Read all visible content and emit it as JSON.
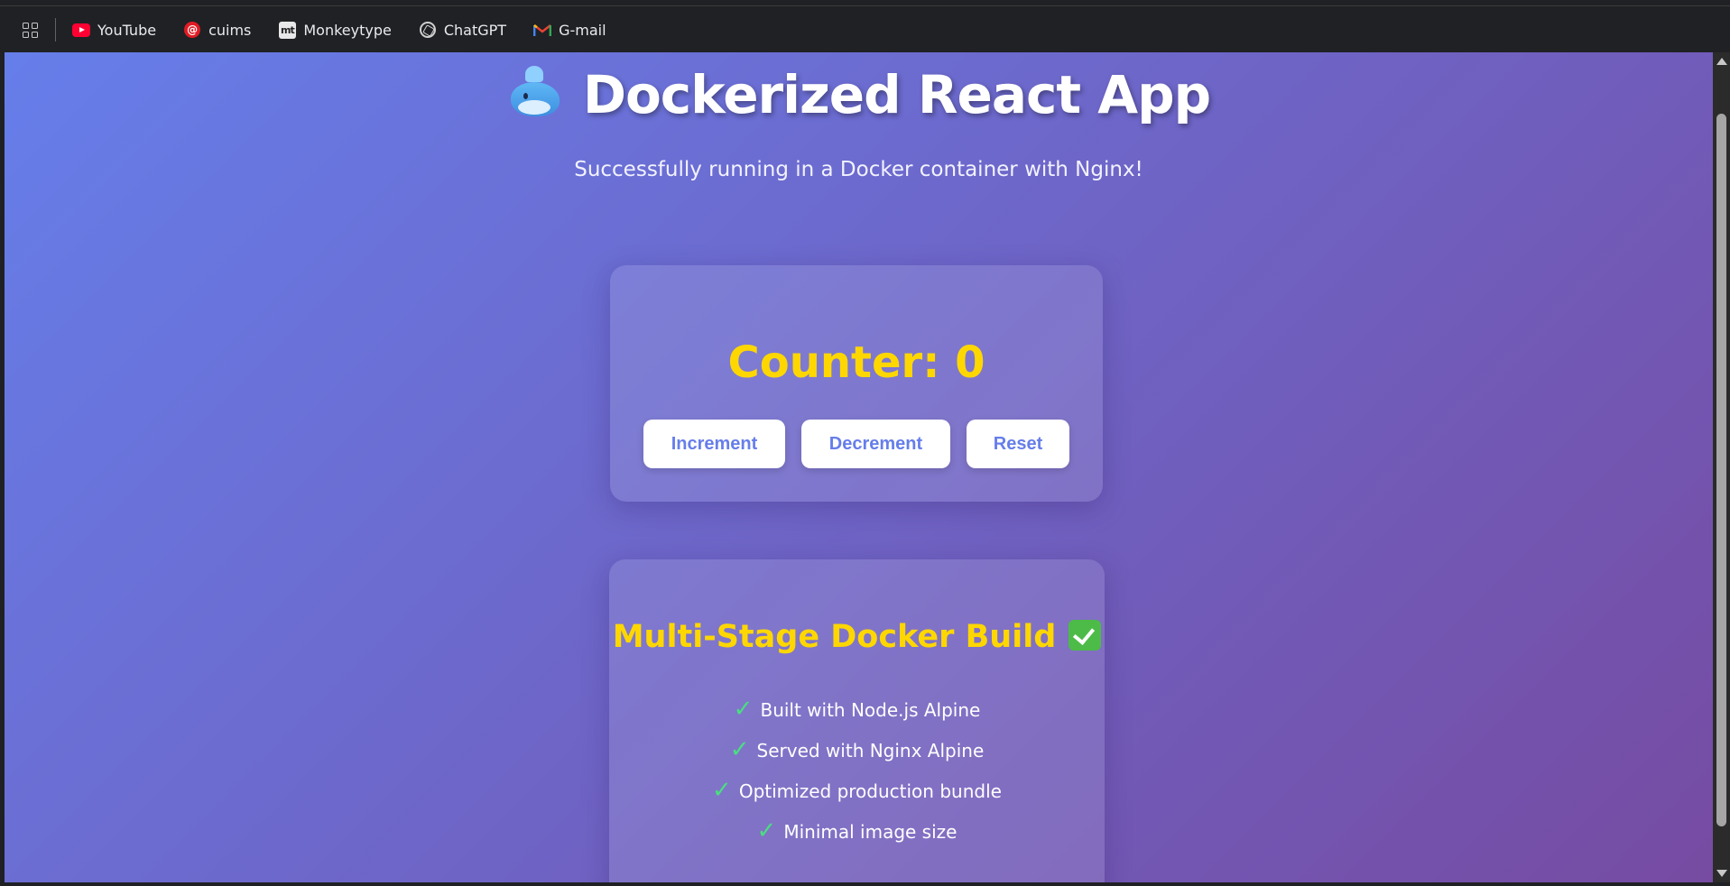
{
  "bookmarks": [
    {
      "label": "YouTube",
      "icon": "youtube-icon"
    },
    {
      "label": "cuims",
      "icon": "cuims-icon"
    },
    {
      "label": "Monkeytype",
      "icon": "monkeytype-icon"
    },
    {
      "label": "ChatGPT",
      "icon": "chatgpt-icon"
    },
    {
      "label": "G-mail",
      "icon": "gmail-icon"
    }
  ],
  "bookmark_icons_text": {
    "monkeytype": "mt",
    "cuims": "@"
  },
  "header": {
    "title": "Dockerized React App",
    "title_emoji": "whale-spouting-icon",
    "subtitle": "Successfully running in a Docker container with Nginx!"
  },
  "counter": {
    "label": "Counter: 0",
    "value": 0,
    "buttons": {
      "increment": "Increment",
      "decrement": "Decrement",
      "reset": "Reset"
    }
  },
  "build": {
    "title": "Multi-Stage Docker Build",
    "title_icon": "check-mark-button-icon",
    "tick": "✓",
    "features": [
      "Built with Node.js Alpine",
      "Served with Nginx Alpine",
      "Optimized production bundle",
      "Minimal image size"
    ]
  },
  "colors": {
    "gradient_start": "#667eea",
    "gradient_end": "#764ba2",
    "accent_yellow": "#ffd700",
    "tick_green": "#4ade80",
    "button_text": "#667eea"
  }
}
